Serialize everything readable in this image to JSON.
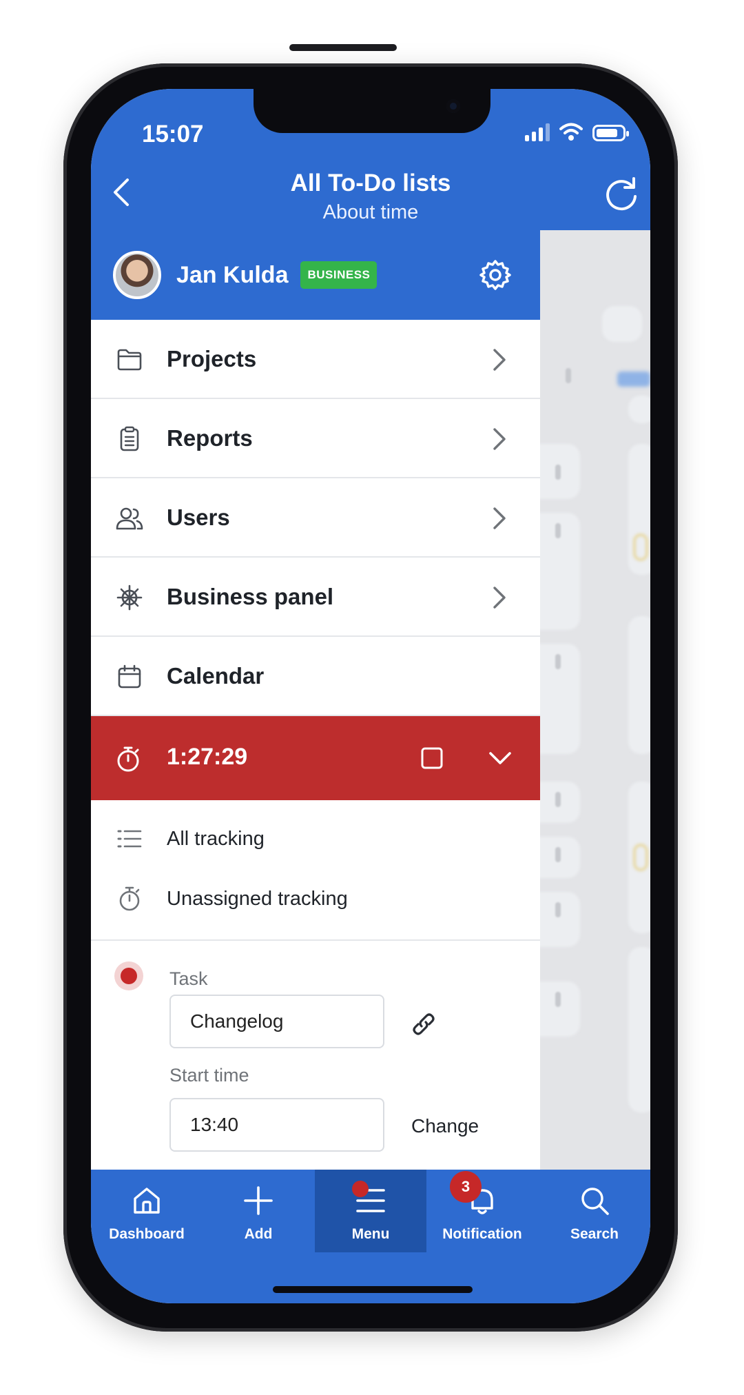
{
  "status_bar": {
    "time": "15:07"
  },
  "header": {
    "title": "All To-Do lists",
    "subtitle": "About time"
  },
  "user": {
    "name": "Jan Kulda",
    "badge": "BUSINESS"
  },
  "menu": {
    "items": [
      {
        "label": "Projects",
        "icon": "folder-icon"
      },
      {
        "label": "Reports",
        "icon": "clipboard-icon"
      },
      {
        "label": "Users",
        "icon": "users-icon"
      },
      {
        "label": "Business panel",
        "icon": "ship-wheel-icon"
      },
      {
        "label": "Calendar",
        "icon": "calendar-icon"
      }
    ]
  },
  "timer": {
    "value": "1:27:29"
  },
  "tracking": {
    "all_label": "All tracking",
    "unassigned_label": "Unassigned tracking"
  },
  "form": {
    "task_label": "Task",
    "task_value": "Changelog",
    "start_time_label": "Start time",
    "start_time_value": "13:40",
    "change_label": "Change"
  },
  "bottom_nav": {
    "dashboard": "Dashboard",
    "add": "Add",
    "menu": "Menu",
    "notification": "Notification",
    "notification_count": "3",
    "search": "Search"
  },
  "colors": {
    "primary": "#2e6bd0",
    "active_nav": "#1f53a8",
    "timer_red": "#bd2d2d",
    "badge_green": "#34b44a",
    "badge_red": "#c62828"
  }
}
